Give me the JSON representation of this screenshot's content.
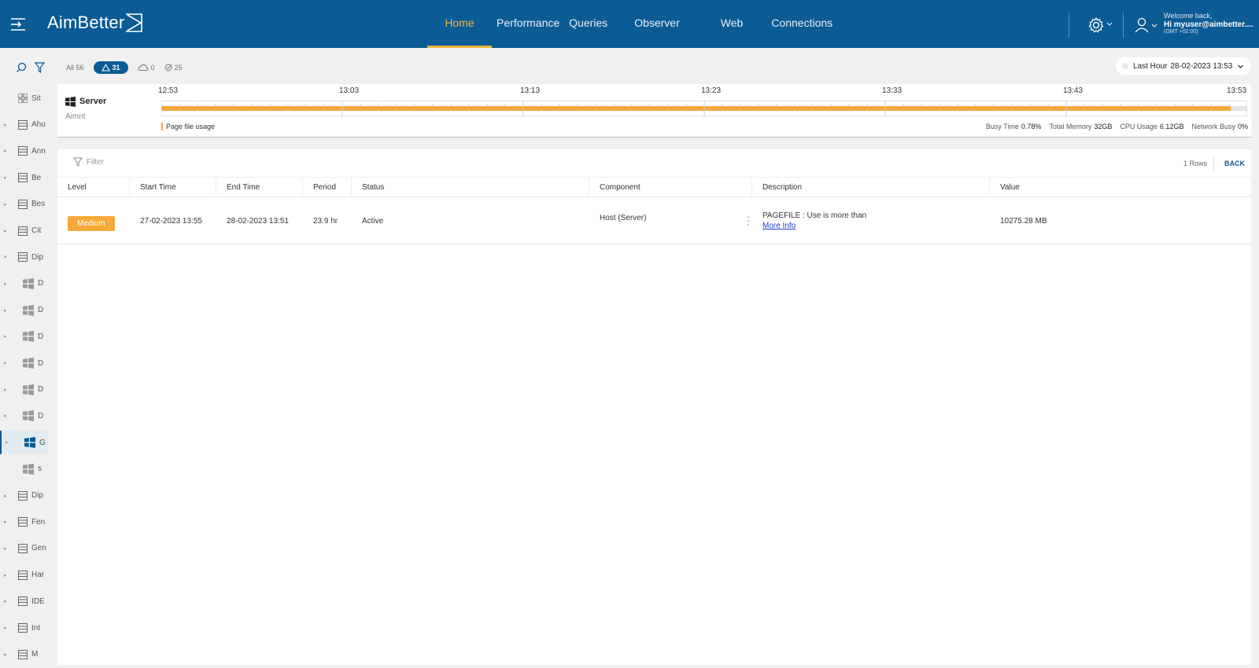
{
  "app": {
    "logo": "AimBetter"
  },
  "nav": {
    "items": [
      "Home",
      "Performance",
      "Queries",
      "Observer",
      "Web",
      "Connections"
    ],
    "active": "Home"
  },
  "user": {
    "welcome": "Welcome back,",
    "name": "Hi myuser@aimbetter....",
    "tz": "(GMT +02:00)"
  },
  "sidebar": {
    "items": [
      {
        "label": "Sit",
        "kind": "grid"
      },
      {
        "label": "Ahu",
        "kind": "group"
      },
      {
        "label": "Ann",
        "kind": "group"
      },
      {
        "label": "Be",
        "kind": "group"
      },
      {
        "label": "Bes",
        "kind": "group"
      },
      {
        "label": "Cit",
        "kind": "group"
      },
      {
        "label": "Dip",
        "kind": "group"
      },
      {
        "label": "D",
        "kind": "server"
      },
      {
        "label": "D",
        "kind": "server"
      },
      {
        "label": "D",
        "kind": "server"
      },
      {
        "label": "D",
        "kind": "server"
      },
      {
        "label": "D",
        "kind": "server"
      },
      {
        "label": "D",
        "kind": "server"
      },
      {
        "label": "G",
        "kind": "server"
      },
      {
        "label": "s",
        "kind": "server"
      },
      {
        "label": "Dip",
        "kind": "group"
      },
      {
        "label": "Fen",
        "kind": "group"
      },
      {
        "label": "Gen",
        "kind": "group"
      },
      {
        "label": "Har",
        "kind": "group"
      },
      {
        "label": "IDE",
        "kind": "group"
      },
      {
        "label": "Int",
        "kind": "group"
      },
      {
        "label": "M",
        "kind": "group"
      }
    ]
  },
  "chips": {
    "all": "All 56",
    "warnings": "31",
    "offline": "0",
    "ok": "25"
  },
  "time_selector": {
    "label": "Last Hour",
    "value": "28-02-2023 13:53"
  },
  "timeline": {
    "server_name": "Server",
    "server_sub": "Aimnt",
    "ticks": [
      "12:53",
      "13:03",
      "13:13",
      "13:23",
      "13:33",
      "13:43",
      "13:53"
    ],
    "active_fraction": 0.985,
    "legend": "Page file usage",
    "metrics": [
      {
        "label": "Busy Time",
        "value": "0.78%"
      },
      {
        "label": "Total Memory",
        "value": "32GB"
      },
      {
        "label": "CPU Usage",
        "value": "6.12GB"
      },
      {
        "label": "Network Busy",
        "value": "0%"
      }
    ]
  },
  "table": {
    "filter_placeholder": "Filter",
    "rows_count": "1 Rows",
    "back": "BACK",
    "headers": [
      "Level",
      "Start Time",
      "End Time",
      "Period",
      "Status",
      "Component",
      "Description",
      "Value"
    ],
    "rows": [
      {
        "level": "Medium",
        "start": "27-02-2023 13:55",
        "end": "28-02-2023 13:51",
        "period": "23.9 hr",
        "status": "Active",
        "component": "Host (Server)",
        "description": "PAGEFILE : Use is more than",
        "more_info": "More Info",
        "value": "10275.28 MB"
      }
    ]
  },
  "colors": {
    "header": "#0b5b95",
    "accent": "#f5b73b",
    "warning": "#f5a93b"
  }
}
